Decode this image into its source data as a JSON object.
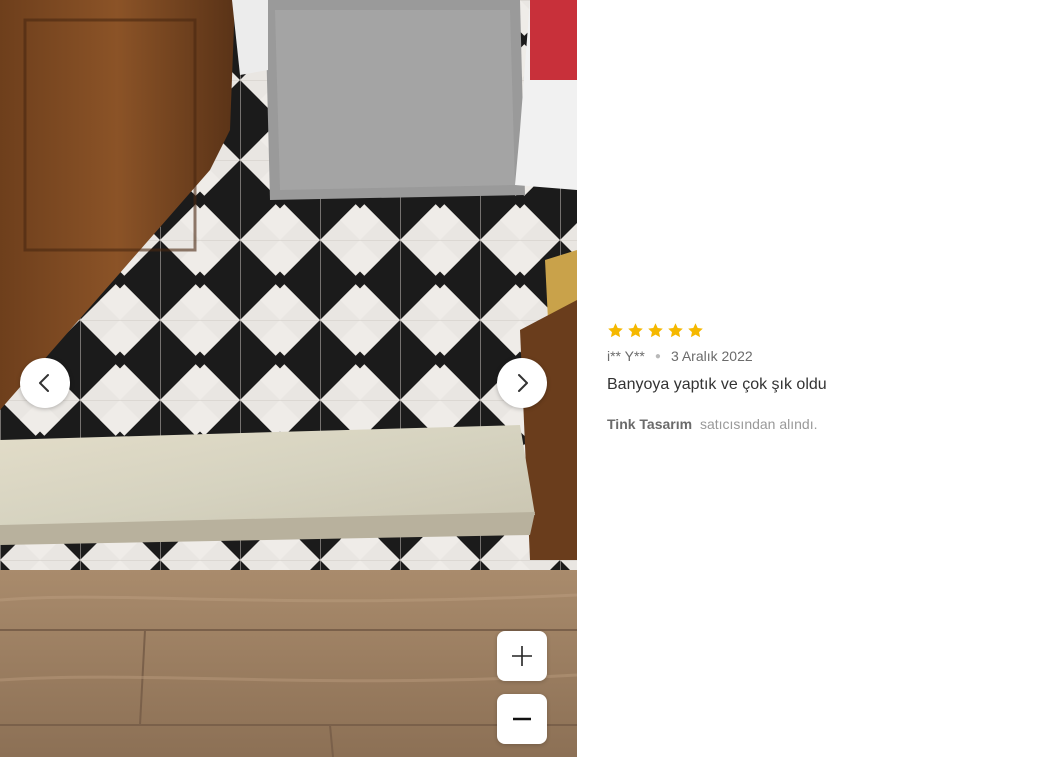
{
  "gallery": {
    "image_alt": "Review photo: bathroom floor with black and white geometric tile stickers",
    "prev_icon": "chevron-left-icon",
    "next_icon": "chevron-right-icon",
    "zoom_in_icon": "plus-icon",
    "zoom_out_icon": "minus-icon"
  },
  "review": {
    "rating": 5,
    "max_rating": 5,
    "star_color": "#f5b800",
    "author": "i** Y**",
    "date": "3 Aralık 2022",
    "comment": "Banyoya yaptık ve çok şık oldu",
    "seller_name": "Tink Tasarım",
    "seller_suffix": "satıcısından alındı."
  }
}
